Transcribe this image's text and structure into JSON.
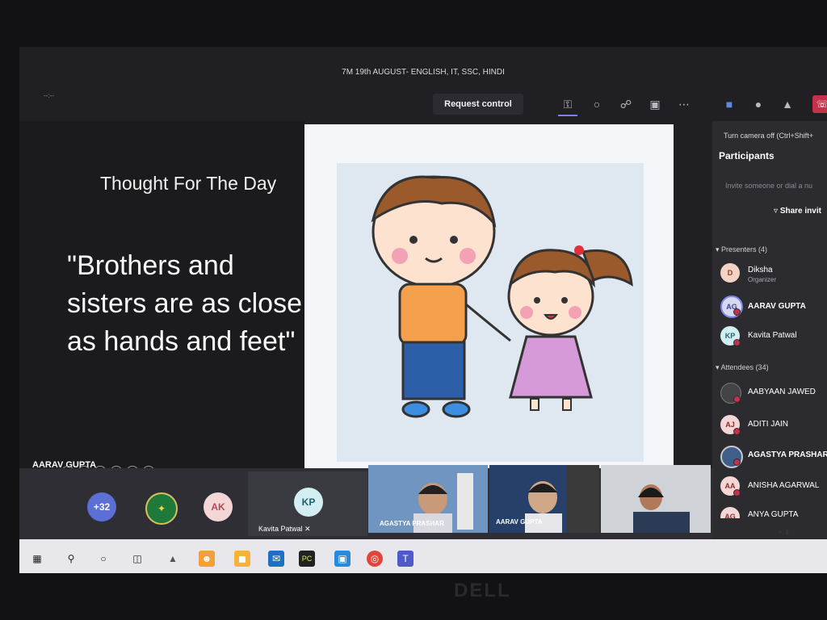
{
  "meeting": {
    "title": "7M 19th AUGUST- ENGLISH, IT, SSC, HINDI",
    "timer": "--:--"
  },
  "toolbar": {
    "request_control": "Request control",
    "camera_tooltip": "Turn camera off (Ctrl+Shift+",
    "icons": [
      "participants-icon",
      "chat-icon",
      "reactions-icon",
      "rooms-icon",
      "more-icon",
      "camera-icon",
      "mic-icon",
      "share-icon",
      "hangup-icon"
    ]
  },
  "slide": {
    "heading": "Thought For The Day",
    "quote": "\"Brothers and sisters are as  close as hands and feet\"",
    "presenter": "AARAV GUPTA"
  },
  "panel": {
    "title": "Participants",
    "invite_placeholder": "Invite someone or dial a nu",
    "share_invite": "Share invit",
    "presenters_header": "Presenters (4)",
    "attendees_header": "Attendees (34)",
    "presenters": [
      {
        "initials": "D",
        "name": "Diksha",
        "role": "Organizer",
        "color": "#f4d2c4",
        "text": "#8a3a20"
      },
      {
        "initials": "AG",
        "name": "AARAV GUPTA",
        "role": "",
        "color": "#d7d8f2",
        "text": "#3b3f8c"
      },
      {
        "initials": "KP",
        "name": "Kavita Patwal",
        "role": "",
        "color": "#d2eef2",
        "text": "#1d6470"
      }
    ],
    "attendees": [
      {
        "initials": "",
        "name": "AABYAAN JAWED",
        "color": "#444448",
        "text": "#ffffff"
      },
      {
        "initials": "AJ",
        "name": "ADITI JAIN",
        "color": "#f5d6d6",
        "text": "#8c2a2a"
      },
      {
        "initials": "",
        "name": "AGASTYA PRASHAR",
        "color": "#3f5f8a",
        "text": "#ffffff"
      },
      {
        "initials": "AA",
        "name": "ANISHA AGARWAL",
        "color": "#f5d6d6",
        "text": "#8c2a2a"
      },
      {
        "initials": "AG",
        "name": "ANYA GUPTA",
        "color": "#f5d6d6",
        "text": "#8c2a2a"
      }
    ]
  },
  "strip": {
    "overflow_count": "+32",
    "ak_initials": "AK",
    "kp_initials": "KP",
    "kp_name": "Kavita Patwal",
    "tile_labels": [
      "AGASTYA PRASHAR",
      "AARAV GUPTA"
    ]
  },
  "taskbar": {
    "icons": [
      "windows-icon",
      "search-icon",
      "cortana-icon",
      "task-view-icon",
      "app-icon",
      "scratch-icon",
      "app-icon-2",
      "mail-icon",
      "pycharm-icon",
      "store-icon",
      "chrome-icon",
      "teams-icon"
    ]
  },
  "bezel": {
    "brand": "DELL"
  }
}
